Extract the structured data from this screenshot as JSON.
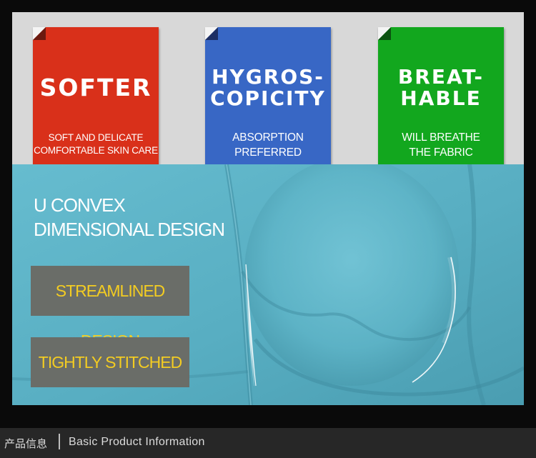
{
  "cards": [
    {
      "title": "SOFTER",
      "subtitle_lines": [
        "SOFT AND DELICATE",
        "COMFORTABLE SKIN CARE"
      ],
      "color": "#d9301a"
    },
    {
      "title_lines": [
        "HYGROS-",
        "COPICITY"
      ],
      "subtitle_lines": [
        "ABSORPTION",
        "PREFERRED"
      ],
      "color": "#3867c5"
    },
    {
      "title_lines": [
        "BREAT-",
        "HABLE"
      ],
      "subtitle_lines": [
        "WILL BREATHE",
        "THE FABRIC"
      ],
      "color": "#12a71e"
    }
  ],
  "fabric_section": {
    "heading_lines": [
      "U CONVEX",
      "DIMENSIONAL DESIGN"
    ],
    "features": [
      "STREAMLINED DESIGN",
      "TIGHTLY STITCHED"
    ],
    "fabric_color": "#5cb3c7",
    "feature_text_color": "#f3cc22"
  },
  "footer": {
    "chinese_label": "产品信息",
    "english_label": "Basic Product Information"
  }
}
